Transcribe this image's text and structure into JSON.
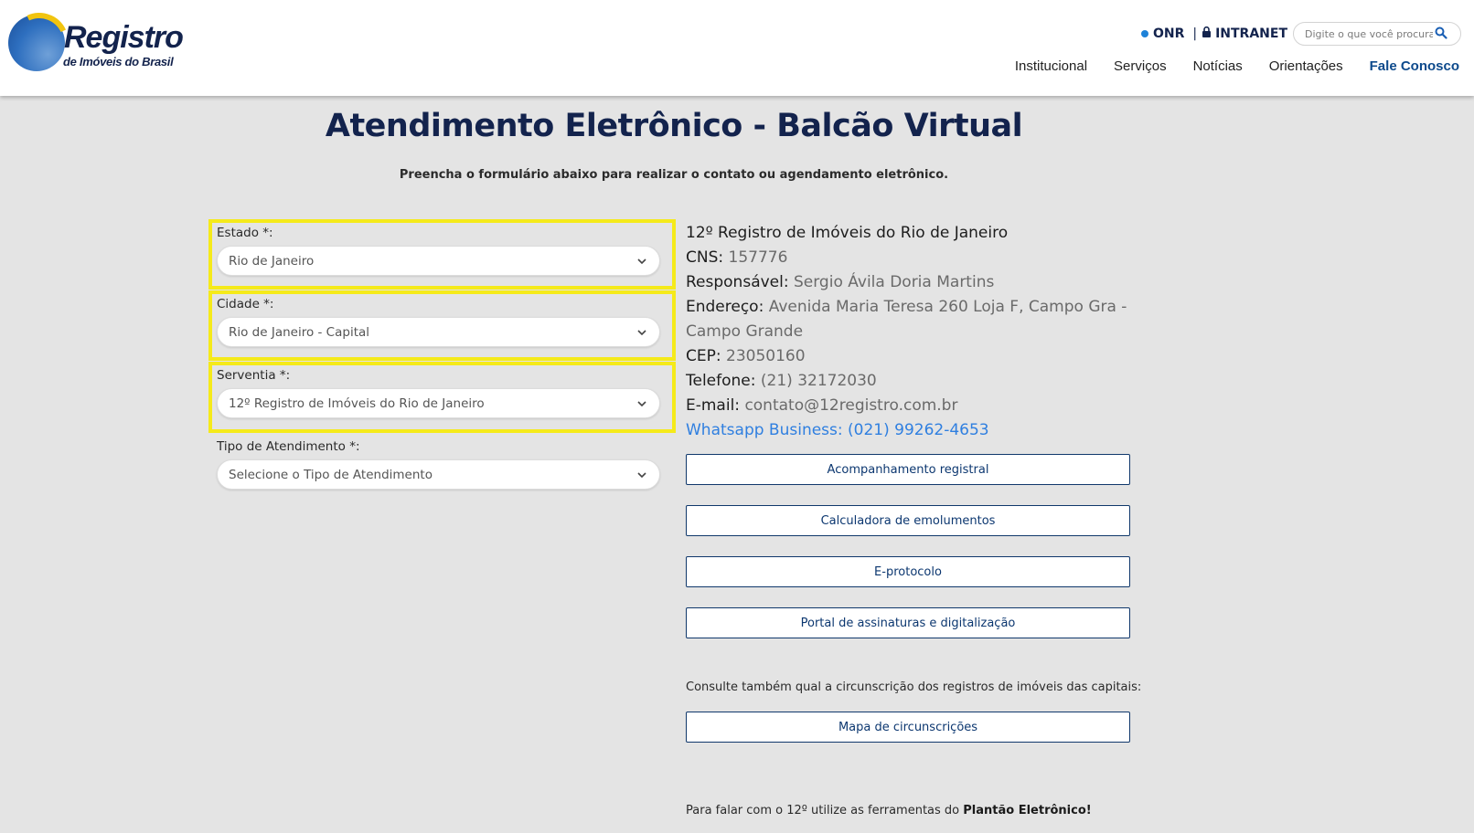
{
  "header": {
    "logo_title": "Registro",
    "logo_subtitle": "de Imóveis do Brasil",
    "util_onr": "ONR",
    "util_sep": "|",
    "util_intranet": "INTRANET",
    "search_placeholder": "Digite o que você procura",
    "nav": [
      "Institucional",
      "Serviços",
      "Notícias",
      "Orientações",
      "Fale Conosco"
    ]
  },
  "page": {
    "title": "Atendimento Eletrônico - Balcão Virtual",
    "subtitle": "Preencha o formulário abaixo para realizar o contato ou agendamento eletrônico."
  },
  "form": {
    "estado": {
      "label": "Estado *:",
      "value": "Rio de Janeiro"
    },
    "cidade": {
      "label": "Cidade *:",
      "value": "Rio de Janeiro - Capital"
    },
    "serventia": {
      "label": "Serventia *:",
      "value": "12º Registro de Imóveis do Rio de Janeiro"
    },
    "tipo": {
      "label": "Tipo de Atendimento *:",
      "value": "Selecione o Tipo de Atendimento"
    }
  },
  "info": {
    "name": "12º Registro de Imóveis do Rio de Janeiro",
    "cns_label": "CNS:",
    "cns": "157776",
    "responsavel_label": "Responsável:",
    "responsavel": "Sergio Ávila Doria Martins",
    "endereco_label": "Endereço:",
    "endereco": "Avenida Maria Teresa 260 Loja F, Campo Gra -",
    "endereco_2": "Campo Grande",
    "cep_label": "CEP:",
    "cep": "23050160",
    "telefone_label": "Telefone:",
    "telefone": "(21) 32172030",
    "email_label": "E-mail:",
    "email": "contato@12registro.com.br",
    "whatsapp_label": "Whatsapp Business:",
    "whatsapp": "(021) 99262-4653"
  },
  "buttons": {
    "acompanhamento": "Acompanhamento registral",
    "calculadora": "Calculadora de emolumentos",
    "eprotocolo": "E-protocolo",
    "portal": "Portal de assinaturas e digitalização",
    "mapa": "Mapa de circunscrições"
  },
  "consulte": "Consulte também qual a circunscrição dos registros de imóveis das capitais:",
  "footer": {
    "prefix": "Para falar com o 12º utilize as ferramentas do",
    "bold": "Plantão Eletrônico!"
  },
  "colors": {
    "highlight_outline": "#f5ea1a",
    "brand_navy": "#13234d",
    "link_blue": "#2f7fe0"
  }
}
